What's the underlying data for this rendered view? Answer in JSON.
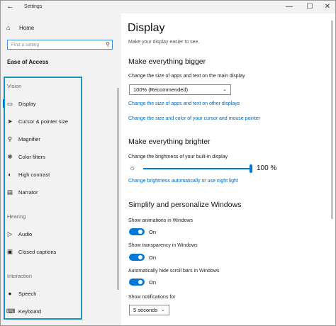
{
  "window": {
    "title": "Settings",
    "back_icon": "back-arrow-icon",
    "controls": [
      "minimize-icon",
      "maximize-icon",
      "close-icon"
    ]
  },
  "sidebar": {
    "home_label": "Home",
    "search_placeholder": "Find a setting",
    "category": "Ease of Access",
    "sections": [
      {
        "label": "Vision",
        "items": [
          {
            "label": "Display",
            "icon": "monitor-icon",
            "selected": true
          },
          {
            "label": "Cursor & pointer size",
            "icon": "cursor-icon"
          },
          {
            "label": "Magnifier",
            "icon": "magnifier-icon"
          },
          {
            "label": "Color filters",
            "icon": "color-filter-icon"
          },
          {
            "label": "High contrast",
            "icon": "high-contrast-icon"
          },
          {
            "label": "Narrator",
            "icon": "narrator-icon"
          }
        ]
      },
      {
        "label": "Hearing",
        "items": [
          {
            "label": "Audio",
            "icon": "speaker-icon"
          },
          {
            "label": "Closed captions",
            "icon": "closed-captions-icon"
          }
        ]
      },
      {
        "label": "Interaction",
        "items": [
          {
            "label": "Speech",
            "icon": "microphone-icon"
          },
          {
            "label": "Keyboard",
            "icon": "keyboard-icon"
          }
        ]
      }
    ]
  },
  "main": {
    "title": "Display",
    "subtitle": "Make your display easier to see.",
    "bigger": {
      "heading": "Make everything bigger",
      "size_label": "Change the size of apps and text on the main display",
      "size_value": "100% (Recommended)",
      "link_other_displays": "Change the size of apps and text on other displays",
      "link_cursor": "Change the size and color of your cursor and mouse pointer"
    },
    "brighter": {
      "heading": "Make everything brighter",
      "brightness_label": "Change the brightness of your built-in display",
      "brightness_value": 100,
      "brightness_text": "100 %",
      "link_night_light": "Change brightness automatically or use night light"
    },
    "simplify": {
      "heading": "Simplify and personalize Windows",
      "animations_label": "Show animations in Windows",
      "animations_state": "On",
      "transparency_label": "Show transparency in Windows",
      "transparency_state": "On",
      "scrollbars_label": "Automatically hide scroll bars in Windows",
      "scrollbars_state": "On",
      "notifications_label": "Show notifications for",
      "notifications_value": "5 seconds"
    }
  },
  "colors": {
    "accent": "#0078d7",
    "link": "#0067b8",
    "focus_outline": "#1b97bf",
    "sidebar_bg": "#f2f2f2"
  }
}
